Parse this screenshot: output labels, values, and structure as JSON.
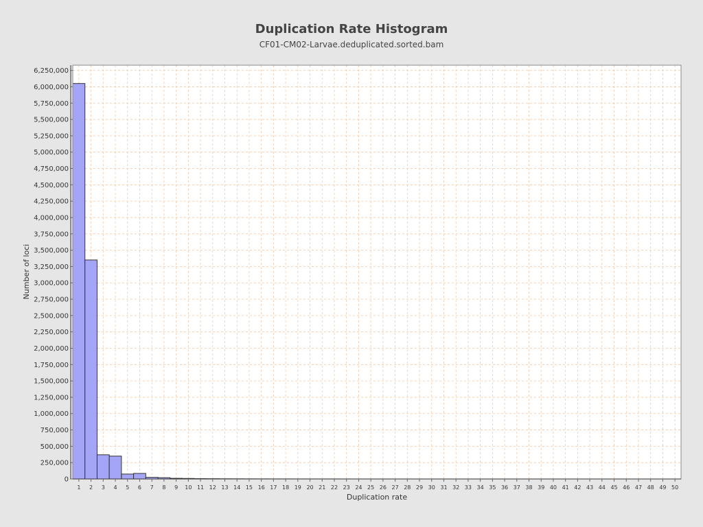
{
  "chart_data": {
    "type": "bar",
    "title": "Duplication Rate Histogram",
    "subtitle": "CF01-CM02-Larvae.deduplicated.sorted.bam",
    "xlabel": "Duplication rate",
    "ylabel": "Number of loci",
    "xlim": [
      0.5,
      50.5
    ],
    "ylim": [
      0,
      6330000
    ],
    "y_tick_step": 250000,
    "y_tick_labels": [
      "0",
      "250,000",
      "500,000",
      "750,000",
      "1,000,000",
      "1,250,000",
      "1,500,000",
      "1,750,000",
      "2,000,000",
      "2,250,000",
      "2,500,000",
      "2,750,000",
      "3,000,000",
      "3,250,000",
      "3,500,000",
      "3,750,000",
      "4,000,000",
      "4,250,000",
      "4,500,000",
      "4,750,000",
      "5,000,000",
      "5,250,000",
      "5,500,000",
      "5,750,000",
      "6,000,000",
      "6,250,000"
    ],
    "x_tick_labels": [
      "1",
      "2",
      "3",
      "4",
      "5",
      "6",
      "7",
      "8",
      "9",
      "10",
      "11",
      "12",
      "13",
      "14",
      "15",
      "16",
      "17",
      "18",
      "19",
      "20",
      "21",
      "22",
      "23",
      "24",
      "25",
      "26",
      "27",
      "28",
      "29",
      "30",
      "31",
      "32",
      "33",
      "34",
      "35",
      "36",
      "37",
      "38",
      "39",
      "40",
      "41",
      "42",
      "43",
      "44",
      "45",
      "46",
      "47",
      "48",
      "49",
      "50"
    ],
    "x": [
      1,
      2,
      3,
      4,
      5,
      6,
      7,
      8,
      9,
      10,
      11,
      12,
      13,
      14,
      15,
      16,
      17,
      18,
      19,
      20,
      21,
      22,
      23,
      24,
      25,
      26,
      27,
      28,
      29,
      30,
      31,
      32,
      33,
      34,
      35,
      36,
      37,
      38,
      39,
      40,
      41,
      42,
      43,
      44,
      45,
      46,
      47,
      48,
      49,
      50
    ],
    "values": [
      6050000,
      3350000,
      370000,
      350000,
      75000,
      85000,
      25000,
      20000,
      10000,
      8000,
      5000,
      4000,
      3000,
      2500,
      2000,
      1500,
      1200,
      1000,
      900,
      800,
      700,
      600,
      500,
      450,
      400,
      350,
      300,
      280,
      250,
      230,
      210,
      200,
      180,
      170,
      160,
      150,
      140,
      130,
      120,
      110,
      100,
      95,
      90,
      85,
      80,
      75,
      70,
      65,
      60,
      55
    ],
    "grid": true,
    "colors": {
      "bar_fill": "#a5a5f7",
      "bar_stroke": "#333333",
      "grid": "#f0c8a8",
      "plot_bg": "#ffffff",
      "page_bg": "#e6e6e6"
    }
  }
}
